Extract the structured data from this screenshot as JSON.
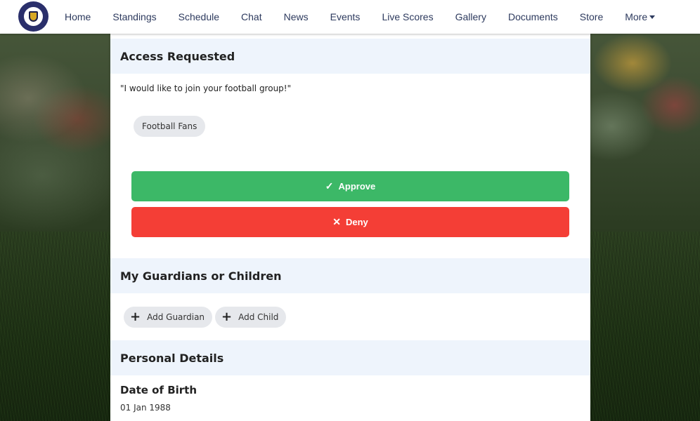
{
  "nav": {
    "items": [
      {
        "label": "Home"
      },
      {
        "label": "Standings"
      },
      {
        "label": "Schedule"
      },
      {
        "label": "Chat"
      },
      {
        "label": "News"
      },
      {
        "label": "Events"
      },
      {
        "label": "Live Scores"
      },
      {
        "label": "Gallery"
      },
      {
        "label": "Documents"
      },
      {
        "label": "Store"
      }
    ],
    "more_label": "More"
  },
  "access": {
    "title": "Access Requested",
    "message": "\"I would like to join your football group!\"",
    "group_chip": "Football Fans",
    "approve_label": "Approve",
    "deny_label": "Deny"
  },
  "guardians": {
    "title": "My Guardians or Children",
    "add_guardian_label": "Add Guardian",
    "add_child_label": "Add Child"
  },
  "personal": {
    "title": "Personal Details",
    "dob_label": "Date of Birth",
    "dob_value": "01 Jan 1988"
  },
  "colors": {
    "approve": "#3cb867",
    "deny": "#f43e36",
    "section_header_bg": "#eef4fc",
    "nav_text": "#2d3a5e",
    "logo": "#2a2f6b"
  },
  "icons": {
    "approve": "check-icon",
    "deny": "close-icon",
    "add": "plus-icon",
    "more": "caret-down-icon"
  }
}
